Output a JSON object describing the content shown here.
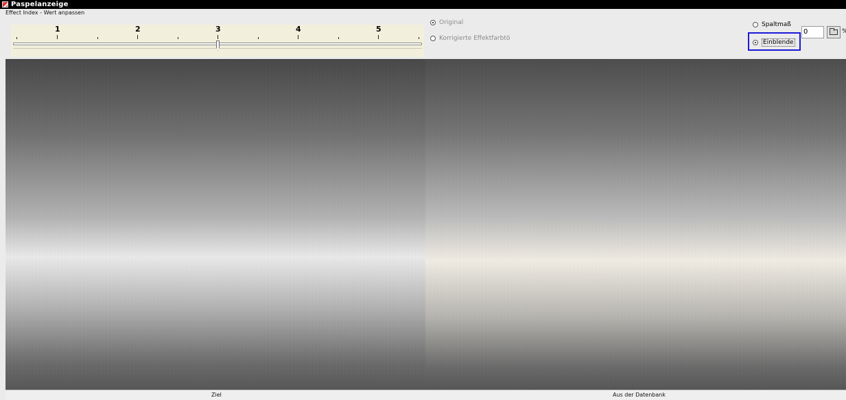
{
  "window": {
    "title": "Paspelanzeige"
  },
  "effect_index": {
    "label": "Effect Index - Wert anpassen",
    "scale_labels": [
      "1",
      "2",
      "3",
      "4",
      "5"
    ],
    "value": 3
  },
  "view_mode": {
    "original_label": "Original",
    "corrected_label": "Korrigierte Effektfarbtö",
    "selected": "Original"
  },
  "display_options": {
    "spaltmass_label": "Spaltmaß",
    "einblende_label": "Einblende",
    "selected": "Einblende",
    "value": "0",
    "unit": "%"
  },
  "status_bar": {
    "left_label": "Ziel",
    "right_label": "Aus der Datenbank"
  },
  "colors": {
    "highlight": "#1b18d6",
    "titlebar": "#000000"
  },
  "icons": {
    "app": "app-icon",
    "browse": "folder-icon"
  }
}
